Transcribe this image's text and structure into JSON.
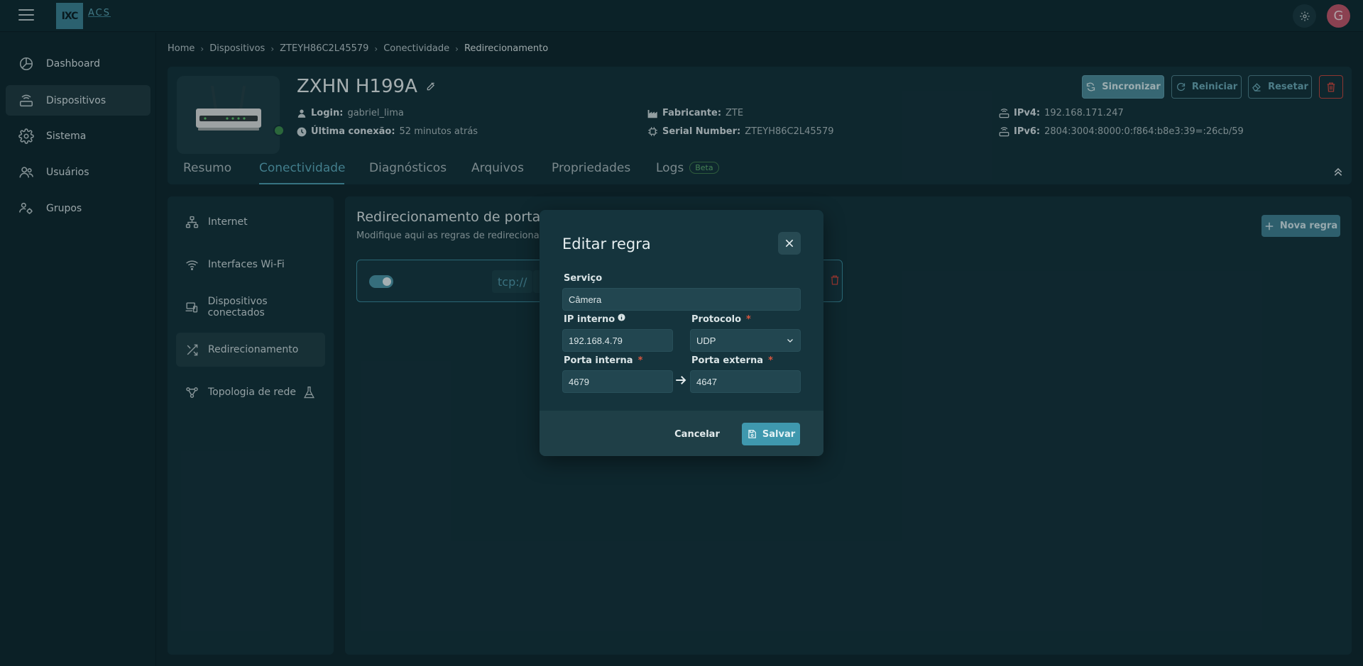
{
  "topbar": {
    "logo_text": "IXC",
    "logo_sub": "ACS",
    "avatar_initial": "G"
  },
  "sidebar": {
    "items": [
      {
        "label": "Dashboard",
        "icon": "dashboard-icon"
      },
      {
        "label": "Dispositivos",
        "icon": "router-icon"
      },
      {
        "label": "Sistema",
        "icon": "gear-icon"
      },
      {
        "label": "Usuários",
        "icon": "users-icon"
      },
      {
        "label": "Grupos",
        "icon": "groups-icon"
      }
    ],
    "active": "Dispositivos"
  },
  "breadcrumb": [
    "Home",
    "Dispositivos",
    "ZTEYH86C2L45579",
    "Conectividade",
    "Redirecionamento"
  ],
  "device": {
    "name": "ZXHN H199A",
    "login_label": "Login:",
    "login_value": "gabriel_lima",
    "last_conn_label": "Última conexão:",
    "last_conn_value": "52 minutos atrás",
    "manufacturer_label": "Fabricante:",
    "manufacturer_value": "ZTE",
    "serial_label": "Serial Number:",
    "serial_value": "ZTEYH86C2L45579",
    "ipv4_label": "IPv4:",
    "ipv4_value": "192.168.171.247",
    "ipv6_label": "IPv6:",
    "ipv6_value": "2804:3004:8000:0:f864:b8e3:39=:26cb/59",
    "status": "online",
    "status_color": "#3b8a4c"
  },
  "header_buttons": {
    "sync": "Sincronizar",
    "restart": "Reiniciar",
    "reset": "Resetar"
  },
  "tabs": {
    "items": [
      "Resumo",
      "Conectividade",
      "Diagnósticos",
      "Arquivos",
      "Propriedades",
      "Logs"
    ],
    "active": "Conectividade",
    "beta_badge": "Beta"
  },
  "submenu": {
    "items": [
      {
        "label": "Internet",
        "icon": "network-icon"
      },
      {
        "label": "Interfaces Wi-Fi",
        "icon": "wifi-icon"
      },
      {
        "label": "Dispositivos conectados",
        "icon": "devices-icon"
      },
      {
        "label": "Redirecionamento",
        "icon": "shuffle-icon"
      },
      {
        "label": "Topologia de rede",
        "icon": "topology-icon"
      }
    ],
    "active": "Redirecionamento"
  },
  "main": {
    "title": "Redirecionamento de portas",
    "subtitle": "Modifique aqui as regras de redirecionam",
    "new_rule_button": "Nova regra",
    "rule_row": {
      "enabled": true,
      "protocol_chip": "tcp://"
    }
  },
  "modal": {
    "title": "Editar regra",
    "service_label": "Serviço",
    "service_value": "Câmera",
    "ip_label": "IP interno",
    "ip_value": "192.168.4.79",
    "protocol_label": "Protocolo",
    "protocol_value": "UDP",
    "internal_port_label": "Porta interna",
    "internal_port_value": "4679",
    "external_port_label": "Porta externa",
    "external_port_value": "4647",
    "cancel": "Cancelar",
    "save": "Salvar"
  },
  "colors": {
    "accent": "#3f98ae",
    "danger": "#d9563f",
    "success": "#3b8a4c",
    "background": "#0e262d"
  }
}
